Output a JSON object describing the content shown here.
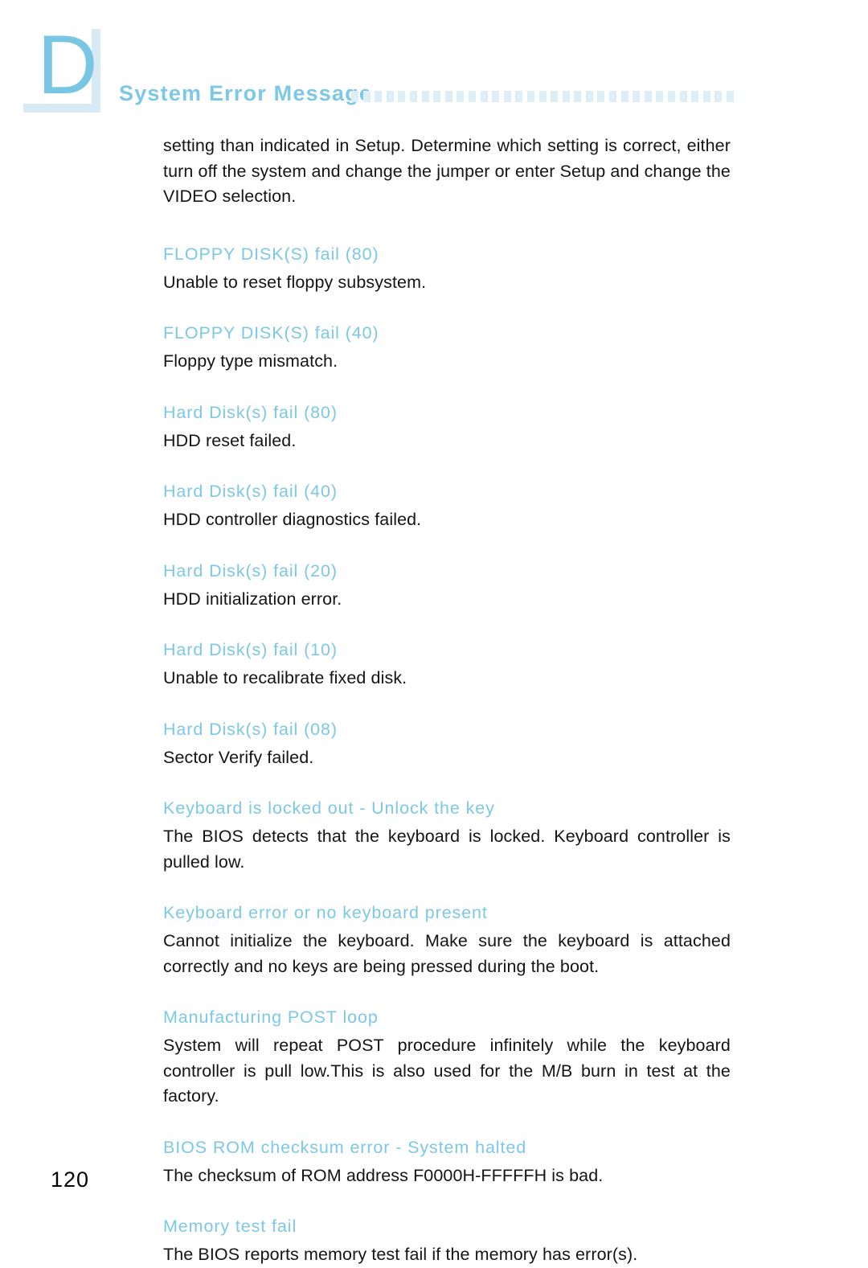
{
  "header": {
    "chapter_letter": "D",
    "title": "System Error Message",
    "dot_count": 33,
    "accent_color": "#7cc8e6",
    "dot_color": "#deeef8",
    "tab_shadow_color": "#d8eaf6"
  },
  "intro": {
    "text": "setting than indicated in Setup. Determine which setting is correct, either turn off the system and change the jumper or enter Setup and change the VIDEO selection."
  },
  "entries": [
    {
      "heading": "FLOPPY DISK(S) fail (80)",
      "body": "Unable to reset floppy subsystem."
    },
    {
      "heading": "FLOPPY DISK(S) fail (40)",
      "body": "Floppy type mismatch."
    },
    {
      "heading": "Hard Disk(s) fail (80)",
      "body": "HDD reset failed."
    },
    {
      "heading": "Hard Disk(s) fail (40)",
      "body": "HDD controller diagnostics failed."
    },
    {
      "heading": "Hard Disk(s) fail (20)",
      "body": "HDD initialization error."
    },
    {
      "heading": "Hard Disk(s) fail (10)",
      "body": "Unable to recalibrate fixed disk."
    },
    {
      "heading": "Hard Disk(s) fail (08)",
      "body": "Sector Verify failed."
    },
    {
      "heading": "Keyboard is locked out - Unlock the key",
      "body": "The BIOS detects that the keyboard is locked. Keyboard controller is pulled low."
    },
    {
      "heading": "Keyboard error or no keyboard present",
      "body": "Cannot initialize the keyboard. Make sure the keyboard is attached correctly and no keys are being pressed during the boot."
    },
    {
      "heading": "Manufacturing POST loop",
      "body": "System will repeat POST procedure infinitely while the keyboard controller is pull low.This is also used for the M/B burn in test at the factory."
    },
    {
      "heading": "BIOS ROM checksum error - System halted",
      "body": "The checksum of ROM address F0000H-FFFFFH is bad."
    },
    {
      "heading": "Memory test fail",
      "body": "The BIOS reports memory test fail if the memory has error(s)."
    }
  ],
  "footer": {
    "page_number": "120"
  }
}
